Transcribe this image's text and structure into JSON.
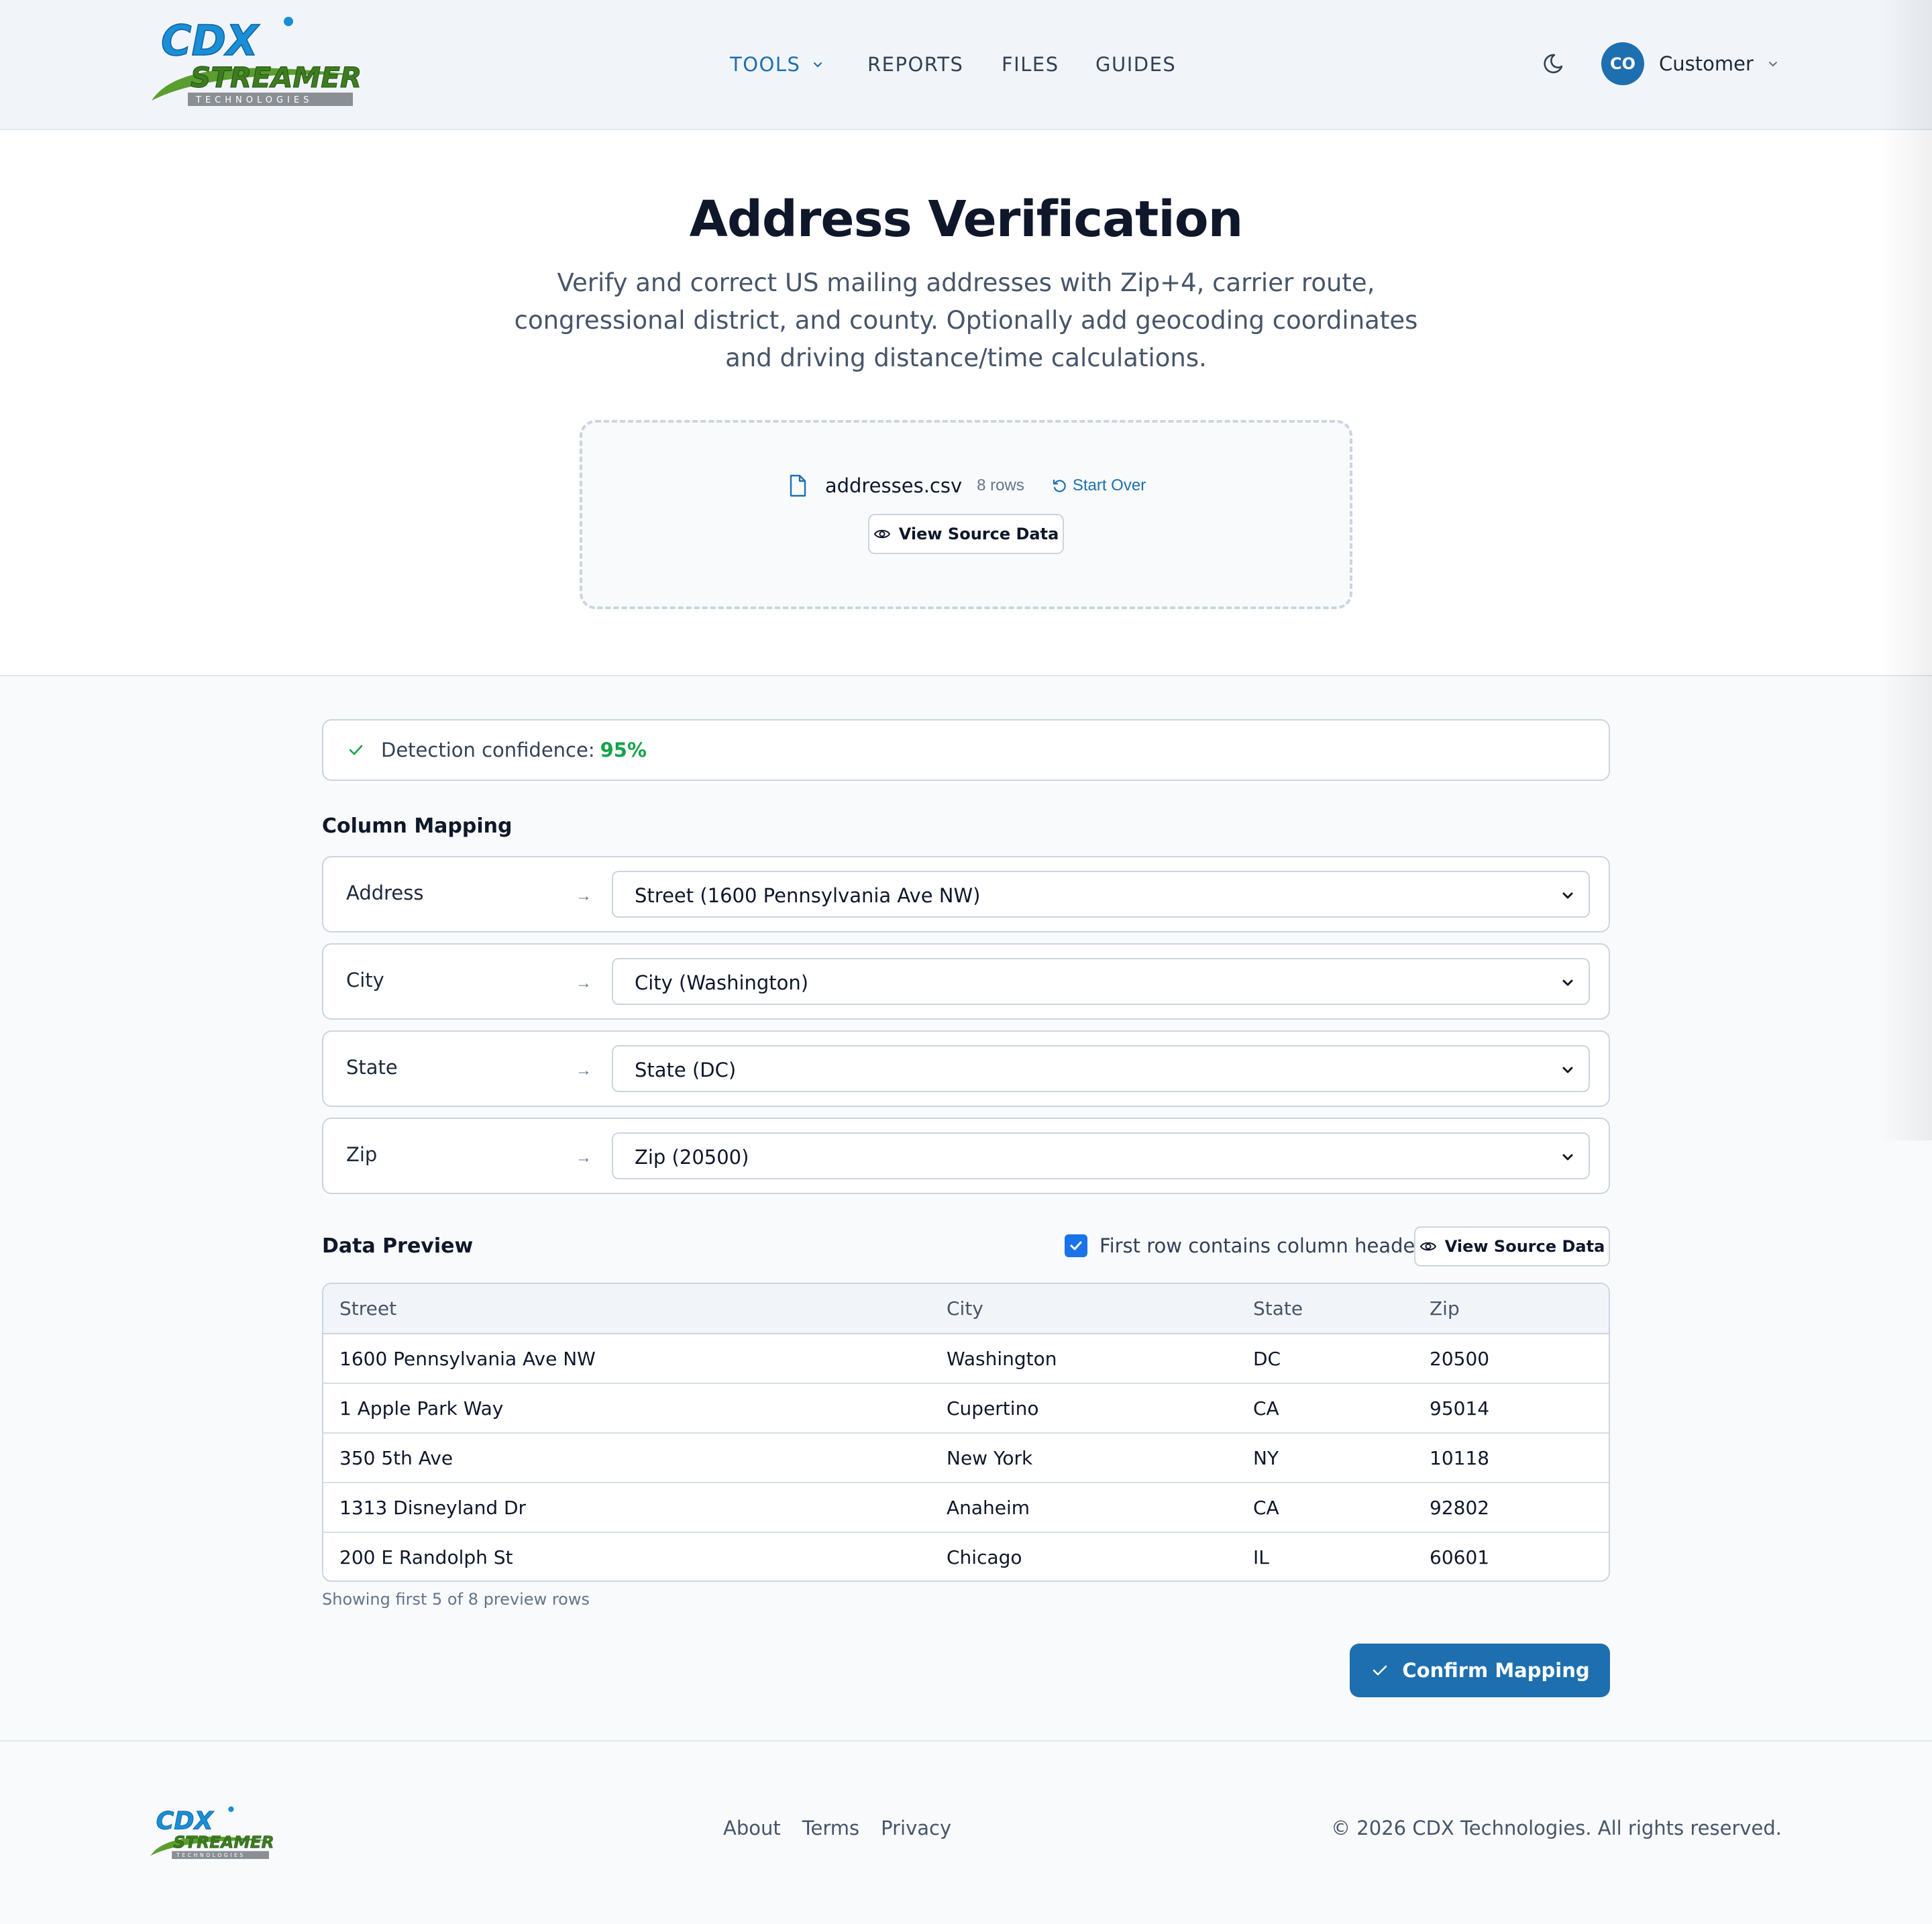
{
  "brand": {
    "logo_main": "CDX",
    "logo_sub": "STREAMER",
    "logo_tag": "TECHNOLOGIES",
    "primary_color": "#1d6fb0",
    "accent_green": "#5a9e2f"
  },
  "nav": {
    "items": [
      {
        "label": "TOOLS",
        "active": true,
        "has_dropdown": true
      },
      {
        "label": "REPORTS"
      },
      {
        "label": "FILES"
      },
      {
        "label": "GUIDES"
      }
    ],
    "theme_icon": "moon-icon",
    "user": {
      "initials": "CO",
      "name": "Customer"
    }
  },
  "hero": {
    "title": "Address Verification",
    "description": "Verify and correct US mailing addresses with Zip+4, carrier route, congressional district, and county. Optionally add geocoding coordinates and driving distance/time calculations."
  },
  "upload": {
    "file_name": "addresses.csv",
    "row_count": "8 rows",
    "start_over": "Start Over",
    "view_source": "View Source Data"
  },
  "detection": {
    "label": "Detection confidence:",
    "value": "95%",
    "color": "#16a34a"
  },
  "mapping": {
    "title": "Column Mapping",
    "arrow": "→",
    "rows": [
      {
        "field": "Address",
        "selected": "Street (1600 Pennsylvania Ave NW)"
      },
      {
        "field": "City",
        "selected": "City (Washington)"
      },
      {
        "field": "State",
        "selected": "State (DC)"
      },
      {
        "field": "Zip",
        "selected": "Zip (20500)"
      }
    ]
  },
  "preview": {
    "title": "Data Preview",
    "header_checkbox_label": "First row contains column headers",
    "header_checkbox_checked": true,
    "view_source": "View Source Data",
    "columns": [
      "Street",
      "City",
      "State",
      "Zip"
    ],
    "rows": [
      [
        "1600 Pennsylvania Ave NW",
        "Washington",
        "DC",
        "20500"
      ],
      [
        "1 Apple Park Way",
        "Cupertino",
        "CA",
        "95014"
      ],
      [
        "350 5th Ave",
        "New York",
        "NY",
        "10118"
      ],
      [
        "1313 Disneyland Dr",
        "Anaheim",
        "CA",
        "92802"
      ],
      [
        "200 E Randolph St",
        "Chicago",
        "IL",
        "60601"
      ]
    ],
    "note": "Showing first 5 of 8 preview rows"
  },
  "actions": {
    "confirm": "Confirm Mapping"
  },
  "footer": {
    "links": [
      "About",
      "Terms",
      "Privacy"
    ],
    "copyright": "© 2026 CDX Technologies. All rights reserved."
  }
}
